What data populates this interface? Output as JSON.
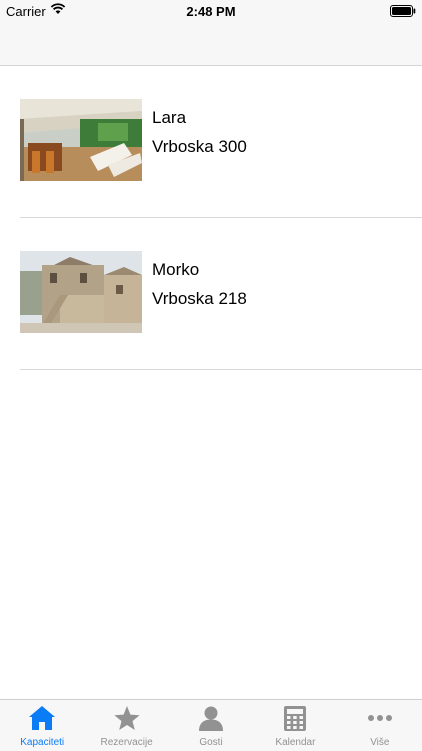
{
  "status_bar": {
    "carrier": "Carrier",
    "time": "2:48 PM"
  },
  "properties": [
    {
      "name": "Lara",
      "address": "Vrboska 300"
    },
    {
      "name": "Morko",
      "address": "Vrboska 218"
    }
  ],
  "tab_bar": {
    "accent_color": "#0a7cf5",
    "inactive_color": "#929292",
    "tabs": [
      {
        "label": "Kapaciteti",
        "icon": "home-icon",
        "active": true
      },
      {
        "label": "Rezervacije",
        "icon": "star-icon",
        "active": false
      },
      {
        "label": "Gosti",
        "icon": "person-icon",
        "active": false
      },
      {
        "label": "Kalendar",
        "icon": "calculator-icon",
        "active": false
      },
      {
        "label": "Više",
        "icon": "more-icon",
        "active": false
      }
    ]
  }
}
